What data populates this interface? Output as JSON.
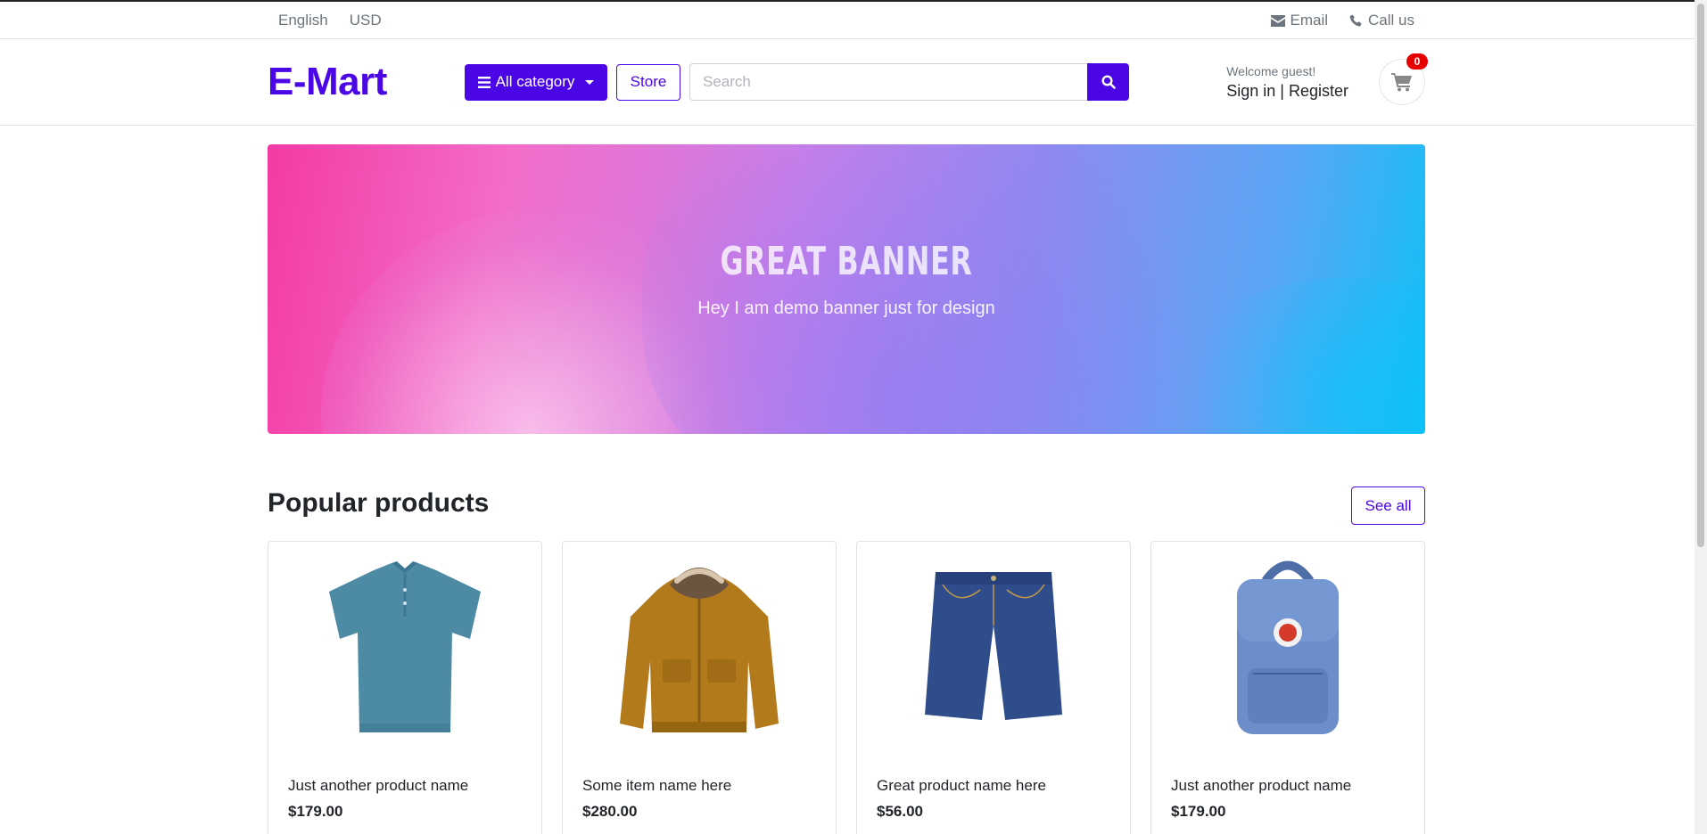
{
  "topbar": {
    "language": "English",
    "currency": "USD",
    "email": "Email",
    "call": "Call us"
  },
  "header": {
    "logo": "E-Mart",
    "category_button": "All category",
    "store_button": "Store",
    "search_placeholder": "Search",
    "welcome": "Welcome guest!",
    "sign_in": "Sign in",
    "separator": "|",
    "register": "Register",
    "cart_count": "0"
  },
  "banner": {
    "title": "GREAT BANNER",
    "subtitle": "Hey I am demo banner just for design"
  },
  "products_section": {
    "title": "Popular products",
    "see_all": "See all",
    "items": [
      {
        "name": "Just another product name",
        "price": "$179.00",
        "image_icon": "polo-shirt-icon"
      },
      {
        "name": "Some item name here",
        "price": "$280.00",
        "image_icon": "jacket-icon"
      },
      {
        "name": "Great product name here",
        "price": "$56.00",
        "image_icon": "jeans-shorts-icon"
      },
      {
        "name": "Just another product name",
        "price": "$179.00",
        "image_icon": "backpack-icon"
      }
    ]
  },
  "colors": {
    "primary": "#4b06e6",
    "badge": "#e60000"
  }
}
